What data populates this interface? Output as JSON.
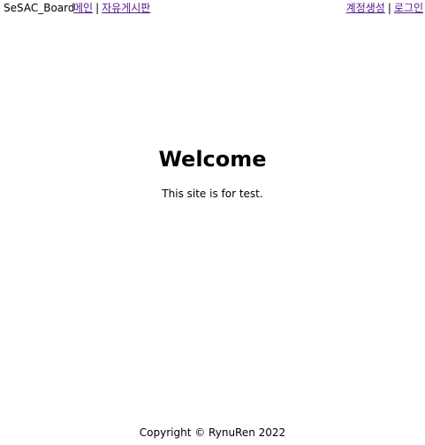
{
  "header": {
    "brand": "SeSAC_Board",
    "nav_left": [
      {
        "label": "메인"
      },
      {
        "label": "자유게시판"
      }
    ],
    "nav_right": [
      {
        "label": "계정생성"
      },
      {
        "label": "로그인"
      }
    ],
    "separator": "|"
  },
  "main": {
    "title": "Welcome",
    "subtitle": "This site is for test."
  },
  "footer": {
    "text": "Copyright © RynuRen 2022"
  },
  "colors": {
    "link": "#551a8b",
    "text": "#000000",
    "background": "#ffffff"
  }
}
